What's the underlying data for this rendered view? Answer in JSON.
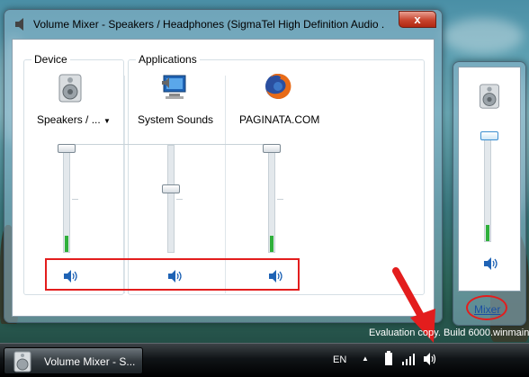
{
  "window": {
    "title": "Volume Mixer - Speakers / Headphones (SigmaTel High Definition Audio ...",
    "close_label": "x"
  },
  "device": {
    "group_label": "Device",
    "name": "Speakers / ...",
    "caret": "▼",
    "volume": 1.0,
    "meter": 0.15,
    "icon": "speaker-icon"
  },
  "applications": {
    "group_label": "Applications",
    "items": [
      {
        "name": "System Sounds",
        "icon": "system-sounds-icon",
        "volume": 0.6,
        "meter": 0.0
      },
      {
        "name": "PAGINATA.COM",
        "icon": "firefox-icon",
        "volume": 1.0,
        "meter": 0.15
      }
    ]
  },
  "popup": {
    "icon": "speaker-icon",
    "volume": 1.0,
    "meter": 0.15,
    "mixer_link": "Mixer"
  },
  "watermark": "Evaluation copy. Build 6000.winmain",
  "taskbar": {
    "task_label": "Volume Mixer - S...",
    "language": "EN"
  },
  "annotation_color": "#e31d1d"
}
